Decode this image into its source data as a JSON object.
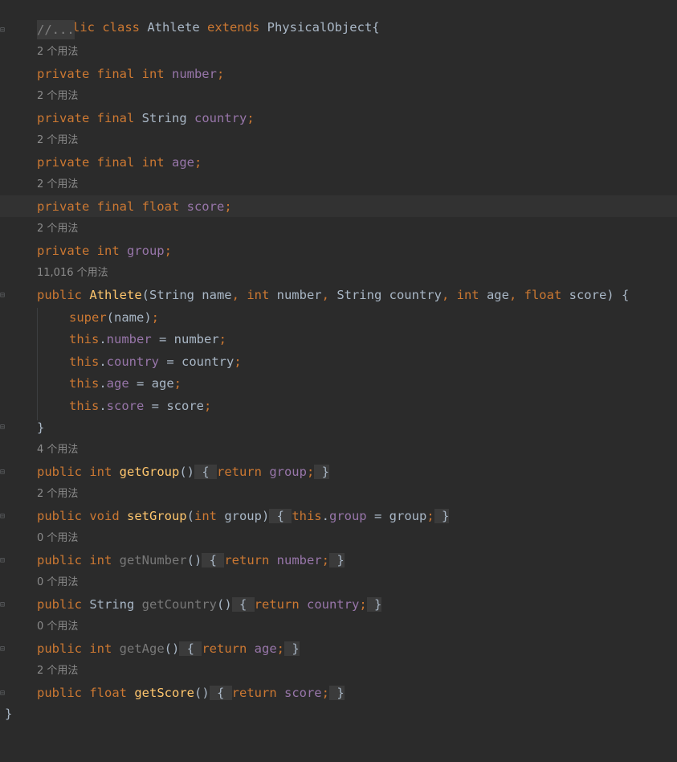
{
  "lines": {
    "l01": {
      "a": "public class ",
      "b": "Athlete ",
      "c": "extends ",
      "d": "PhysicalObject{"
    },
    "l02": {
      "a": "//..."
    },
    "l03": {
      "h": "2 个用法"
    },
    "l04": {
      "a": "private final int ",
      "b": "number",
      ";": ";"
    },
    "l05": {
      "h": "2 个用法"
    },
    "l06": {
      "a": "private final ",
      "b": "String ",
      "c": "country",
      ";": ";"
    },
    "l07": {
      "h": "2 个用法"
    },
    "l08": {
      "a": "private final int ",
      "b": "age",
      ";": ";"
    },
    "l09": {
      "h": "2 个用法"
    },
    "l10": {
      "a": "private final float ",
      "b": "score",
      ";": ";"
    },
    "l11": {
      "h": "2 个用法"
    },
    "l12": {
      "a": "private int ",
      "b": "group",
      ";": ";"
    },
    "l13": {
      "h": "11,016 个用法"
    },
    "l14": {
      "a": "public ",
      "b": "Athlete",
      "c": "(String name",
      ",": ", ",
      "d": "int ",
      "e": "number",
      ",2": ", ",
      "f": "String country",
      ",3": ", ",
      "g": "int ",
      "h": "age",
      ",4": ", ",
      "i": "float ",
      "j": "score) {"
    },
    "l15": {
      "a": "super",
      "b": "(name)",
      ";": ";"
    },
    "l16": {
      "a": "this",
      ".": ".",
      "b": "number",
      " =": " = number",
      ";": ";"
    },
    "l17": {
      "a": "this",
      ".": ".",
      "b": "country",
      " =": " = country",
      ";": ";"
    },
    "l18": {
      "a": "this",
      ".": ".",
      "b": "age",
      " =": " = age",
      ";": ";"
    },
    "l19": {
      "a": "this",
      ".": ".",
      "b": "score",
      " =": " = score",
      ";": ";"
    },
    "l20": {
      "a": "}"
    },
    "l21": {
      "h": "4 个用法"
    },
    "l22": {
      "a": "public int ",
      "b": "getGroup",
      "c": "()",
      "d": " { ",
      "e": "return ",
      "f": "group",
      ";": ";",
      "g": " }"
    },
    "l23": {
      "h": "2 个用法"
    },
    "l24": {
      "a": "public void ",
      "b": "setGroup",
      "c": "(",
      "d": "int ",
      "e": "group)",
      "f": " { ",
      "g": "this",
      ".": ".",
      "i": "group",
      " =": " = group",
      ";": ";",
      "j": " }"
    },
    "l25": {
      "h": "0 个用法"
    },
    "l26": {
      "a": "public int ",
      "b": "getNumber",
      "c": "()",
      "d": " { ",
      "e": "return ",
      "f": "number",
      ";": ";",
      "g": " }"
    },
    "l27": {
      "h": "0 个用法"
    },
    "l28": {
      "a": "public ",
      "b": "String ",
      "c": "getCountry",
      "d": "()",
      "e": " { ",
      "f": "return ",
      "g": "country",
      ";": ";",
      "h": " }"
    },
    "l29": {
      "h": "0 个用法"
    },
    "l30": {
      "a": "public int ",
      "b": "getAge",
      "c": "()",
      "d": " { ",
      "e": "return ",
      "f": "age",
      ";": ";",
      "g": " }"
    },
    "l31": {
      "h": "2 个用法"
    },
    "l32": {
      "a": "public float ",
      "b": "getScore",
      "c": "()",
      "d": " { ",
      "e": "return ",
      "f": "score",
      ";": ";",
      "g": " }"
    },
    "l33": {
      "a": "}"
    }
  },
  "icons": {
    "fold": "fold-marker-icon"
  },
  "colors": {
    "background": "#2b2b2b",
    "keyword": "#cc7832",
    "field": "#9876aa",
    "method": "#ffc66d",
    "text": "#a9b7c6",
    "hint": "#8c8c8c"
  }
}
